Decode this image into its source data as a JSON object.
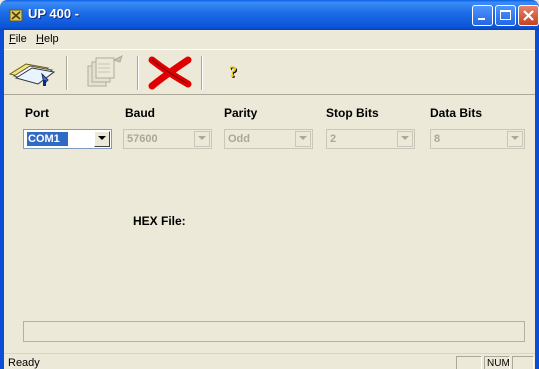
{
  "window": {
    "title": "UP 400 -",
    "title_color": "#0a5ee8"
  },
  "menu": {
    "file_label": "File",
    "help_label": "Help"
  },
  "toolbar": {
    "icons": [
      "open-icon",
      "program-icon",
      "cancel-icon",
      "about-icon"
    ]
  },
  "settings": {
    "port": {
      "label": "Port",
      "value": "COM1",
      "enabled": true
    },
    "baud": {
      "label": "Baud",
      "value": "57600",
      "enabled": false
    },
    "parity": {
      "label": "Parity",
      "value": "Odd",
      "enabled": false
    },
    "stop_bits": {
      "label": "Stop Bits",
      "value": "2",
      "enabled": false
    },
    "data_bits": {
      "label": "Data Bits",
      "value": "8",
      "enabled": false
    }
  },
  "hex_file": {
    "label": "HEX File:"
  },
  "status": {
    "text": "Ready",
    "num": "NUM"
  },
  "colors": {
    "face": "#ece9d8",
    "selection": "#316ac5",
    "cancel_red": "#e00000"
  }
}
